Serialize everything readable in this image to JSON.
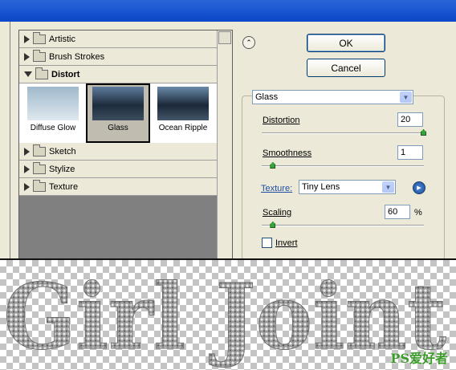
{
  "gallery": {
    "categories": [
      {
        "label": "Artistic",
        "expanded": false
      },
      {
        "label": "Brush Strokes",
        "expanded": false
      },
      {
        "label": "Distort",
        "expanded": true
      },
      {
        "label": "Sketch",
        "expanded": false
      },
      {
        "label": "Stylize",
        "expanded": false
      },
      {
        "label": "Texture",
        "expanded": false
      }
    ],
    "thumbnails": [
      {
        "label": "Diffuse Glow",
        "selected": false
      },
      {
        "label": "Glass",
        "selected": true
      },
      {
        "label": "Ocean Ripple",
        "selected": false
      }
    ]
  },
  "buttons": {
    "ok": "OK",
    "cancel": "Cancel"
  },
  "filter_select": {
    "value": "Glass"
  },
  "params": {
    "distortion": {
      "label": "Distortion",
      "value": "20",
      "level": 20,
      "max": 20
    },
    "smoothness": {
      "label": "Smoothness",
      "value": "1",
      "level": 1,
      "max": 15
    },
    "texture": {
      "label": "Texture:",
      "value": "Tiny Lens"
    },
    "scaling": {
      "label": "Scaling",
      "value": "60",
      "unit": "%",
      "level": 60,
      "min": 50,
      "max": 200
    },
    "invert": {
      "label": "Invert",
      "checked": false
    }
  },
  "preview": {
    "text": "Girl Joint"
  },
  "watermark": "PS爱好者"
}
